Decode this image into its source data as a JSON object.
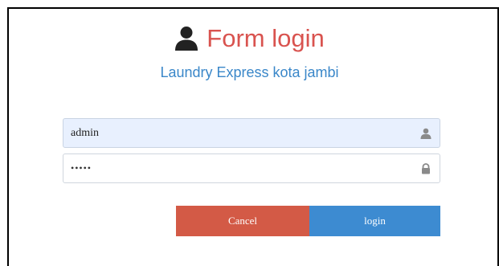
{
  "header": {
    "title": "Form login",
    "subtitle": "Laundry Express kota jambi",
    "title_icon": "user-icon",
    "title_color": "#d9534f",
    "subtitle_color": "#3a87c9"
  },
  "form": {
    "username": {
      "value": "admin",
      "icon": "user-icon"
    },
    "password": {
      "value": "•••••",
      "icon": "lock-icon"
    }
  },
  "buttons": {
    "cancel_label": "Cancel",
    "cancel_color": "#d35a46",
    "login_label": "login",
    "login_color": "#3d8bd1"
  }
}
